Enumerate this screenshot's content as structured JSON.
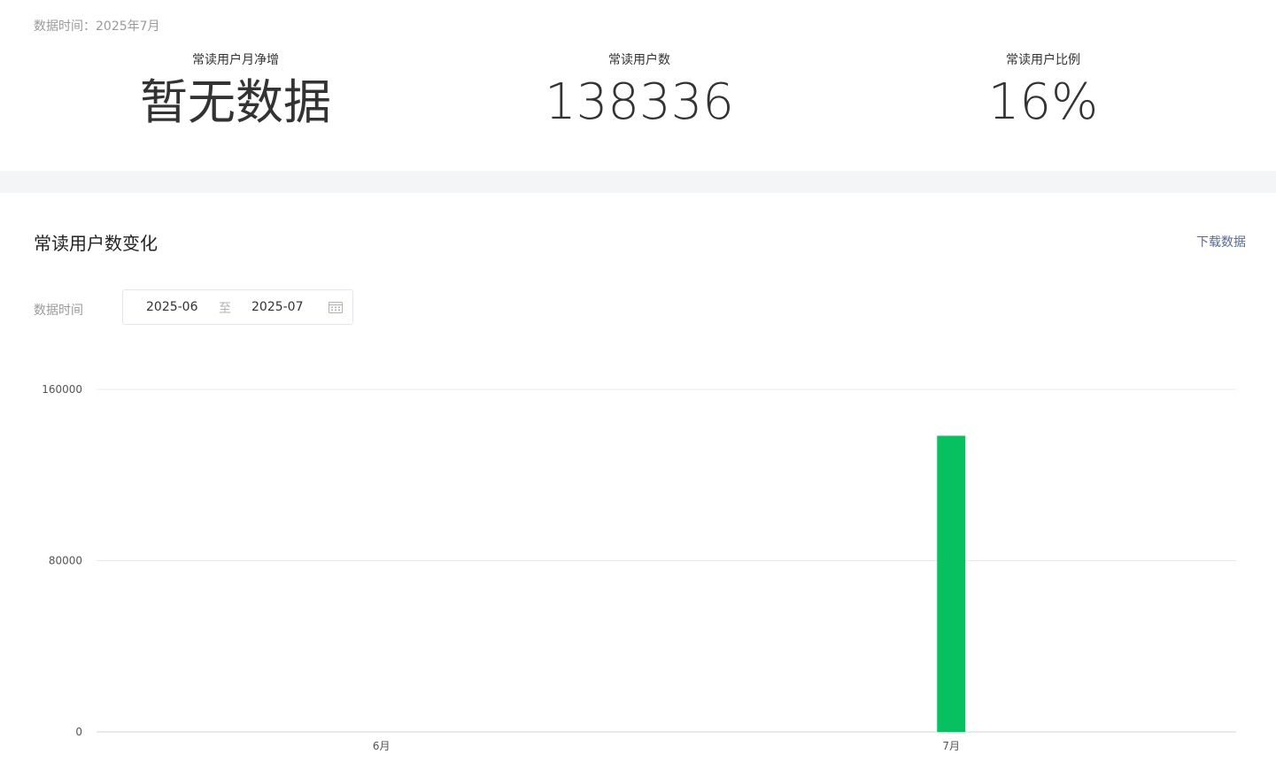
{
  "header": {
    "data_time": "数据时间：2025年7月"
  },
  "stats": [
    {
      "label": "常读用户月净增",
      "value": "暂无数据"
    },
    {
      "label": "常读用户数",
      "value": "138336"
    },
    {
      "label": "常读用户比例",
      "value": "16%"
    }
  ],
  "section": {
    "title": "常读用户数变化",
    "download_label": "下载数据"
  },
  "filter": {
    "label": "数据时间",
    "start": "2025-06",
    "separator": "至",
    "end": "2025-07",
    "icon": "calendar-icon"
  },
  "colors": {
    "bar": "#07c160",
    "grid": "#e8e8e8",
    "link": "#576b95"
  },
  "chart_data": {
    "type": "bar",
    "categories": [
      "6月",
      "7月"
    ],
    "values": [
      0,
      138336
    ],
    "ylim": [
      0,
      160000
    ],
    "yticks": [
      "0",
      "80000",
      "160000"
    ],
    "grid": true,
    "title": "",
    "xlabel": "",
    "ylabel": ""
  }
}
